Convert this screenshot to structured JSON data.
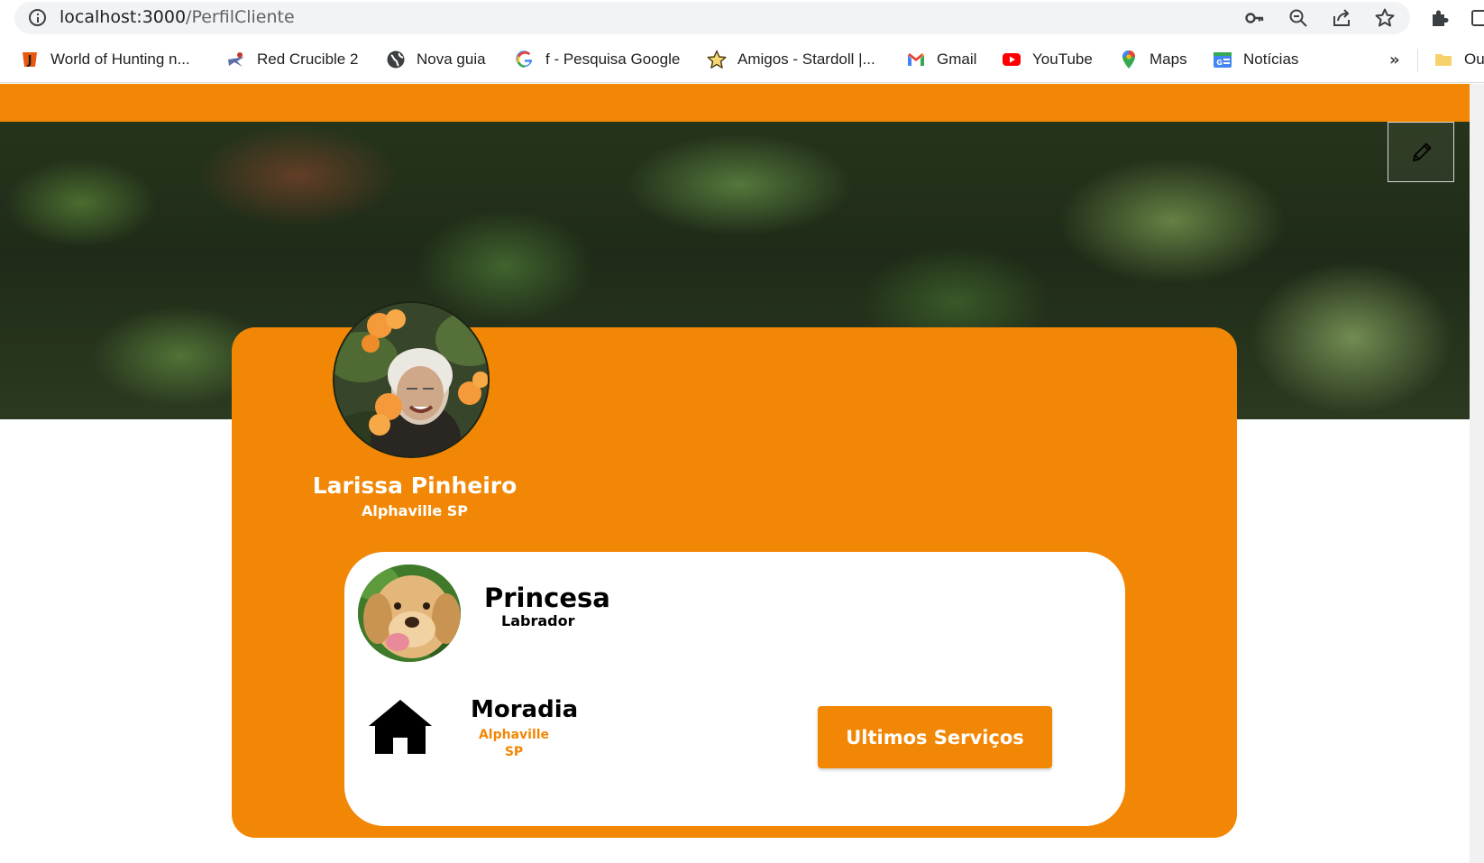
{
  "browser": {
    "url_host": "localhost:3000",
    "url_path": "/PerfilCliente",
    "bookmarks": [
      {
        "label": "World of Hunting n...",
        "icon": "hunting-favicon"
      },
      {
        "label": "Red Crucible 2",
        "icon": "red-crucible-favicon"
      },
      {
        "label": "Nova guia",
        "icon": "globe-icon"
      },
      {
        "label": "f - Pesquisa Google",
        "icon": "google-icon"
      },
      {
        "label": "Amigos - Stardoll |...",
        "icon": "stardoll-star-icon"
      },
      {
        "label": "Gmail",
        "icon": "gmail-icon"
      },
      {
        "label": "YouTube",
        "icon": "youtube-icon"
      },
      {
        "label": "Maps",
        "icon": "maps-pin-icon"
      },
      {
        "label": "Notícias",
        "icon": "news-icon"
      }
    ],
    "more_label": "»",
    "folder_label": "Ou"
  },
  "profile": {
    "name": "Larissa Pinheiro",
    "location": "Alphaville SP"
  },
  "pet": {
    "name": "Princesa",
    "breed": "Labrador"
  },
  "home": {
    "title": "Moradia",
    "line1": "Alphaville",
    "line2": "SP"
  },
  "actions": {
    "services_label": "Ultimos Serviços"
  },
  "colors": {
    "accent": "#f28705",
    "card_inner": "#ffffff",
    "text_dark": "#000000"
  }
}
